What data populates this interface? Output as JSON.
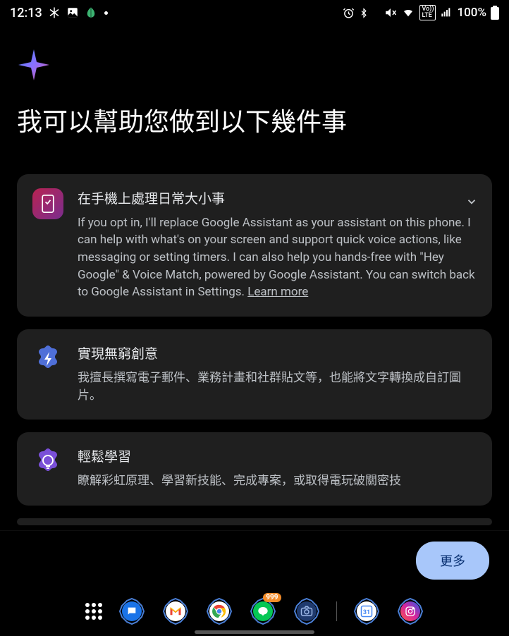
{
  "status": {
    "time": "12:13",
    "battery": "100%",
    "volte": "VoLTE"
  },
  "heading": "我可以幫助您做到以下幾件事",
  "cards": [
    {
      "title": "在手機上處理日常大小事",
      "desc": "If you opt in, I'll replace Google Assistant as your assistant on this phone. I can help with what's on your screen and support quick voice actions, like messaging or setting timers. I can also help you hands-free with \"Hey Google\" & Voice Match, powered by Google Assistant. You can switch back to Google Assistant in Settings. ",
      "link": "Learn more"
    },
    {
      "title": "實現無窮創意",
      "desc": "我擅長撰寫電子郵件、業務計畫和社群貼文等，也能將文字轉換成自訂圖片。"
    },
    {
      "title": "輕鬆學習",
      "desc": "瞭解彩虹原理、學習新技能、完成專案，或取得電玩破關密技"
    }
  ],
  "footer": {
    "more": "更多"
  },
  "nav": {
    "badge": "999"
  }
}
